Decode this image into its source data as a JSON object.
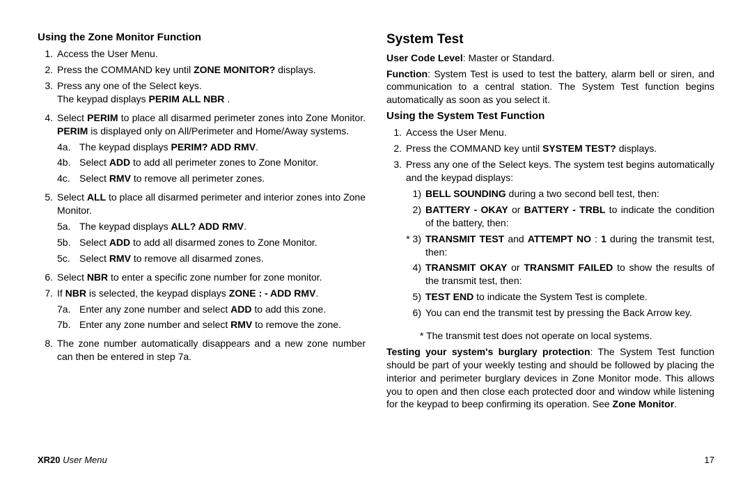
{
  "left": {
    "heading": "Using the Zone Monitor Function",
    "i1": "Access the User Menu.",
    "i2a": "Press the ",
    "i2cmd": "COMMAND",
    "i2b": " key until ",
    "i2zone": "ZONE MONITOR?",
    "i2c": " displays.",
    "i3": "Press any one of the Select keys.",
    "i3sub": "The keypad displays ",
    "i3code": " PERIM  ALL  NBR ",
    "i3dot": ".",
    "i4a": "Select ",
    "i4perim": "PERIM",
    "i4b": " to place all disarmed perimeter zones into Zone Monitor.  ",
    "i4perim2": "PERIM",
    "i4c": " is displayed only on All/Perimeter and Home/Away systems.",
    "i4a_a": "The keypad displays ",
    "i4a_b": "PERIM?  ADD  RMV",
    "i4a_c": ".",
    "i4b_a": "Select ",
    "i4b_b": "ADD",
    "i4b_c": " to add all perimeter zones to Zone Monitor.",
    "i4c_a": "Select ",
    "i4c_b": "RMV",
    "i4c_c": " to remove all perimeter zones.",
    "i5a": "Select ",
    "i5all": "ALL",
    "i5b": " to place all disarmed perimeter and interior zones into Zone Monitor.",
    "i5a_a": "The keypad displays ",
    "i5a_b": "ALL?  ADD  RMV",
    "i5a_c": ".",
    "i5b_a": "Select ",
    "i5b_b": "ADD",
    "i5b_c": " to add all disarmed zones to Zone Monitor.",
    "i5c_a": "Select ",
    "i5c_b": "RMV",
    "i5c_c": " to remove all disarmed zones.",
    "i6a": "Select ",
    "i6nbr": "NBR",
    "i6b": " to enter a specific zone number for zone monitor.",
    "i7a": "If ",
    "i7nbr": "NBR",
    "i7b": " is selected, the keypad displays ",
    "i7code": "ZONE :  -   ADD  RMV",
    "i7c": ".",
    "i7a_a": "Enter any zone number and select ",
    "i7a_b": "ADD",
    "i7a_c": " to add this zone.",
    "i7b_a": "Enter any zone number and select ",
    "i7b_b": "RMV",
    "i7b_c": " to remove the zone.",
    "i8": "The zone number automatically disappears and a new zone number can then be entered in step 7a."
  },
  "right": {
    "title": "System Test",
    "ucl_label": "User Code Level",
    "ucl_value": ":  Master or Standard.",
    "func_label": "Function",
    "func_value": ": System Test is used to test the battery, alarm bell or siren, and communication to a central station.  The System Test function begins automatically as soon as you select it.",
    "heading2": "Using the System Test Function",
    "r1": "Access the User Menu.",
    "r2a": "Press the ",
    "r2cmd": "COMMAND",
    "r2b": " key until ",
    "r2st": "SYSTEM TEST?",
    "r2c": " displays.",
    "r3": "Press any one of the Select keys.  The system test begins automatically and the keypad displays:",
    "s1a": "BELL SOUNDING",
    "s1b": " during a two second bell test, then:",
    "s2a": "BATTERY  - OKAY",
    "s2or": " or ",
    "s2b": "BATTERY   - TRBL",
    "s2c": " to indicate the condition of the battery, then:",
    "s3pre": "* 3)",
    "s3a": "TRANSMIT  TEST",
    "s3and": " and ",
    "s3b": "ATTEMPT  NO ",
    "s3c": " : ",
    "s3one": "1",
    "s3d": " during the transmit test, then:",
    "s4a": "TRANSMIT  OKAY",
    "s4or": " or ",
    "s4b": "TRANSMIT FAILED",
    "s4c": " to show the results of the transmit test, then:",
    "s5a": "TEST END",
    "s5b": " to indicate the System Test is complete.",
    "s6": "You can end the transmit test by pressing the Back Arrow key.",
    "note": "* The transmit test does not operate on local systems.",
    "test_label": "Testing your system's burglary protection",
    "test_value": ": The System Test function should be part of your weekly testing and should be followed by placing the interior and perimeter burglary devices in Zone Monitor mode.  This allows you to open and then close each protected door and window while listening for the keypad to beep confirming its operation.  See ",
    "test_zm": "Zone Monitor",
    "test_dot": "."
  },
  "footer": {
    "manual": "XR20",
    "section": " User Menu",
    "page": "17"
  }
}
